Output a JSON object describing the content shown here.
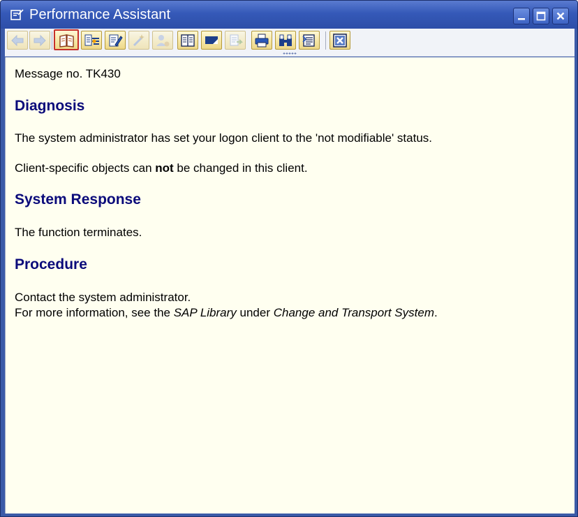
{
  "window": {
    "title": "Performance Assistant"
  },
  "toolbar": {
    "buttons": [
      {
        "name": "back-button",
        "icon": "arrow-left-icon",
        "enabled": false
      },
      {
        "name": "forward-button",
        "icon": "arrow-right-icon",
        "enabled": false
      },
      {
        "name": "application-help-button",
        "icon": "book-open-icon",
        "enabled": true
      },
      {
        "name": "technical-info-button",
        "icon": "technical-info-icon",
        "enabled": true
      },
      {
        "name": "edit-button",
        "icon": "pencil-edit-icon",
        "enabled": true
      },
      {
        "name": "change-button",
        "icon": "wand-icon",
        "enabled": false
      },
      {
        "name": "settings-button",
        "icon": "user-settings-icon",
        "enabled": false
      },
      {
        "name": "glossary-button",
        "icon": "glossary-book-icon",
        "enabled": true
      },
      {
        "name": "bookmark-button",
        "icon": "bookmark-icon",
        "enabled": true
      },
      {
        "name": "export-button",
        "icon": "export-icon",
        "enabled": false
      },
      {
        "name": "print-button",
        "icon": "printer-icon",
        "enabled": true
      },
      {
        "name": "find-button",
        "icon": "binoculars-icon",
        "enabled": true
      },
      {
        "name": "list-button",
        "icon": "list-icon",
        "enabled": true
      },
      {
        "name": "close-help-button",
        "icon": "close-box-icon",
        "enabled": true
      }
    ]
  },
  "message": {
    "number_line": "Message no. TK430",
    "diagnosis_heading": "Diagnosis",
    "diagnosis_text": "The system administrator has set your logon client to the 'not modifiable' status.",
    "client_text_before": "Client-specific objects can ",
    "client_text_bold": "not",
    "client_text_after": " be changed in this client.",
    "response_heading": "System Response",
    "response_text": "The function terminates.",
    "procedure_heading": "Procedure",
    "procedure_line1": "Contact the system administrator.",
    "procedure_line2_a": "For more information, see the ",
    "procedure_line2_b": "SAP Library",
    "procedure_line2_c": " under ",
    "procedure_line2_d": "Change and Transport System",
    "procedure_line2_e": "."
  }
}
